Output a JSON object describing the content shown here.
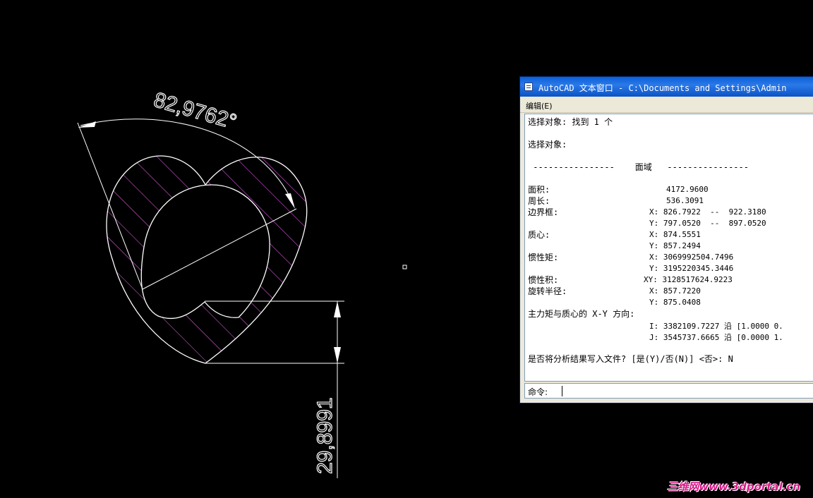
{
  "drawing": {
    "angle_dimension": "82,9762°",
    "length_dimension": "29,8991",
    "colors": {
      "background": "#000000",
      "geometry": "#ffffff",
      "hatch": "#ff66ff"
    }
  },
  "text_window": {
    "title": "AutoCAD 文本窗口 - C:\\Documents and Settings\\Admin",
    "menu": {
      "edit": "编辑(E)"
    },
    "lines": {
      "select_found": "选择对象: 找到 1 个",
      "select": "选择对象:",
      "region_header": " ----------------    面域   ----------------",
      "area_label": "面积:",
      "area_value": "4172.9600",
      "perimeter_label": "周长:",
      "perimeter_value": "536.3091",
      "bbox_label": "边界框:",
      "bbox_x": "X: 826.7922  --  922.3180",
      "bbox_y": "Y: 797.0520  --  897.0520",
      "centroid_label": "质心:",
      "centroid_x": "X: 874.5551",
      "centroid_y": "Y: 857.2494",
      "inertia_label": "惯性矩:",
      "inertia_x": "X: 3069992504.7496",
      "inertia_y": "Y: 3195220345.3446",
      "product_label": "惯性积:",
      "product_xy": "XY: 3128517624.9223",
      "gyration_label": "旋转半径:",
      "gyration_x": "X: 857.7220",
      "gyration_y": "Y: 875.0408",
      "principal_label": "主力矩与质心的 X-Y 方向:",
      "principal_i": "I: 3382109.7227 沿 [1.0000 0.",
      "principal_j": "J: 3545737.6665 沿 [0.0000 1.",
      "write_prompt": "是否将分析结果写入文件? [是(Y)/否(N)] <否>: N"
    },
    "command_label": "命令:"
  },
  "watermark": "三维网www.3dportal.cn"
}
